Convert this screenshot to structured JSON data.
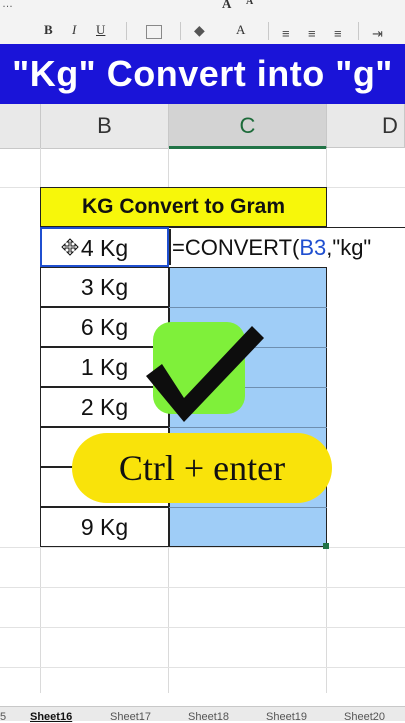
{
  "ribbon": {
    "bold": "B",
    "italic": "I",
    "underline": "U",
    "font_grow": "A",
    "font_shrink": "A",
    "font_color": "A"
  },
  "banner": {
    "title": "\"Kg\" Convert into \"g\""
  },
  "columns": {
    "b": "B",
    "c": "C",
    "d": "D"
  },
  "table": {
    "header": "KG Convert to Gram",
    "rows": [
      {
        "kg": "4 Kg"
      },
      {
        "kg": "3 Kg"
      },
      {
        "kg": "6 Kg"
      },
      {
        "kg": "1 Kg"
      },
      {
        "kg": "2 Kg"
      },
      {
        "kg": ""
      },
      {
        "kg": ""
      },
      {
        "kg": "9 Kg"
      }
    ]
  },
  "formula": {
    "prefix": "=CONVERT(",
    "ref": "B3",
    "suffix": ",\"kg\""
  },
  "overlay": {
    "shortcut": "Ctrl + enter",
    "check_icon": "check-mark-icon"
  },
  "sheets": [
    {
      "name": "5"
    },
    {
      "name": "Sheet16"
    },
    {
      "name": "Sheet17"
    },
    {
      "name": "Sheet18"
    },
    {
      "name": "Sheet19"
    },
    {
      "name": "Sheet20"
    }
  ],
  "colors": {
    "banner_bg": "#1a14d8",
    "header_bg": "#f7f70a",
    "selection_fill": "#9fcdf7",
    "check_bg": "#7ff03a",
    "pill_bg": "#f9e30a",
    "ref_blue": "#1f4fd0",
    "excel_green": "#217346"
  }
}
